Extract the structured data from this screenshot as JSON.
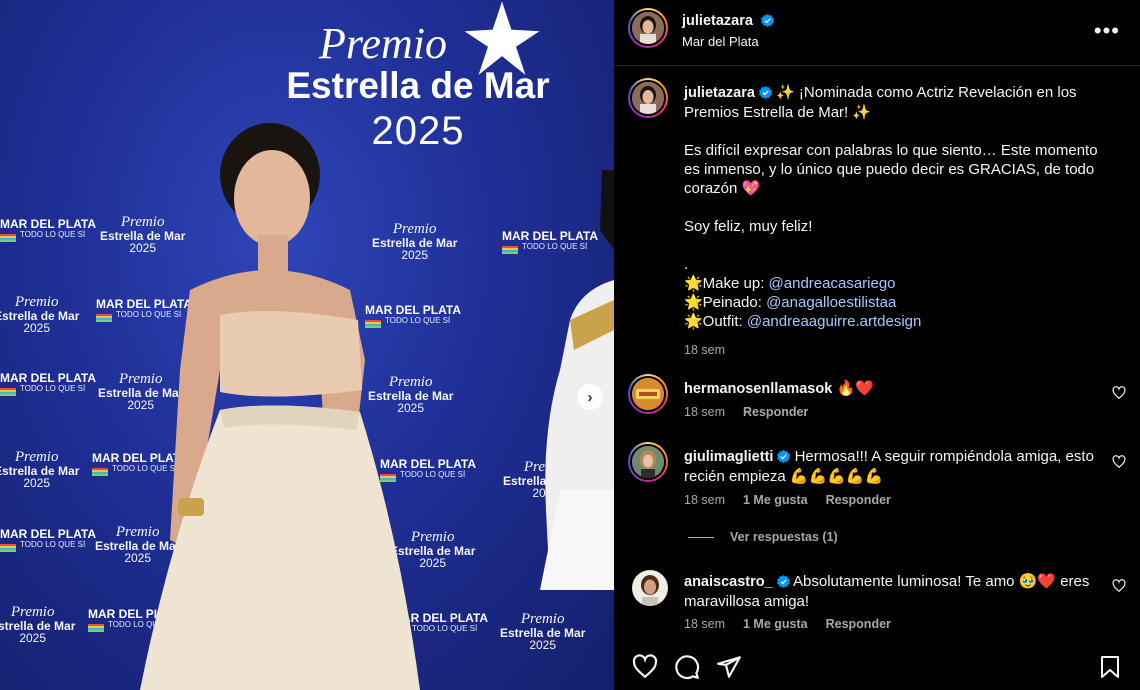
{
  "photo": {
    "backdrop": {
      "premio": "Premio",
      "estrella": "Estrella de Mar",
      "year": "2025",
      "mdp": "MAR DEL PLATA",
      "mdp_tag": "TODO LO QUE SÍ"
    }
  },
  "header": {
    "username": "julietazara",
    "location": "Mar del Plata",
    "more": "•••"
  },
  "caption": {
    "username": "julietazara",
    "line1": " ✨ ¡Nominada como Actriz Revelación en los Premios Estrella de Mar! ✨",
    "para2": "Es difícil expresar con palabras lo que siento… Este momento es inmenso, y lo único que puedo decir es GRACIAS, de todo corazón 💖",
    "para3": "Soy feliz, muy feliz!",
    "dot": ".",
    "credits": [
      {
        "label": "🌟Make up: ",
        "handle": "@andreacasariego"
      },
      {
        "label": "🌟Peinado: ",
        "handle": "@anagalloestilistaa"
      },
      {
        "label": "🌟Outfit: ",
        "handle": "@andreaaguirre.artdesign"
      }
    ],
    "time": "18 sem"
  },
  "comments": [
    {
      "username": "hermanosenllamasok",
      "text": "🔥❤️",
      "time": "18 sem",
      "likes": "",
      "reply": "Responder",
      "verified": false
    },
    {
      "username": "giulimaglietti",
      "text": "Hermosa!!! A seguir rompiéndola amiga, esto recién empieza 💪💪💪💪💪",
      "time": "18 sem",
      "likes": "1 Me gusta",
      "reply": "Responder",
      "verified": true
    },
    {
      "username": "anaiscastro_",
      "text": "Absolutamente luminosa! Te amo 🥹❤️ eres maravillosa amiga!",
      "time": "18 sem",
      "likes": "1 Me gusta",
      "reply": "Responder",
      "verified": true
    }
  ],
  "view_replies": "Ver respuestas (1)",
  "actions": [
    "heart-icon",
    "comment-icon",
    "share-icon",
    "bookmark-icon"
  ],
  "colors": {
    "verified": "#0095f6",
    "link": "#a5c8ff",
    "backdrop": "#1f2f96"
  }
}
